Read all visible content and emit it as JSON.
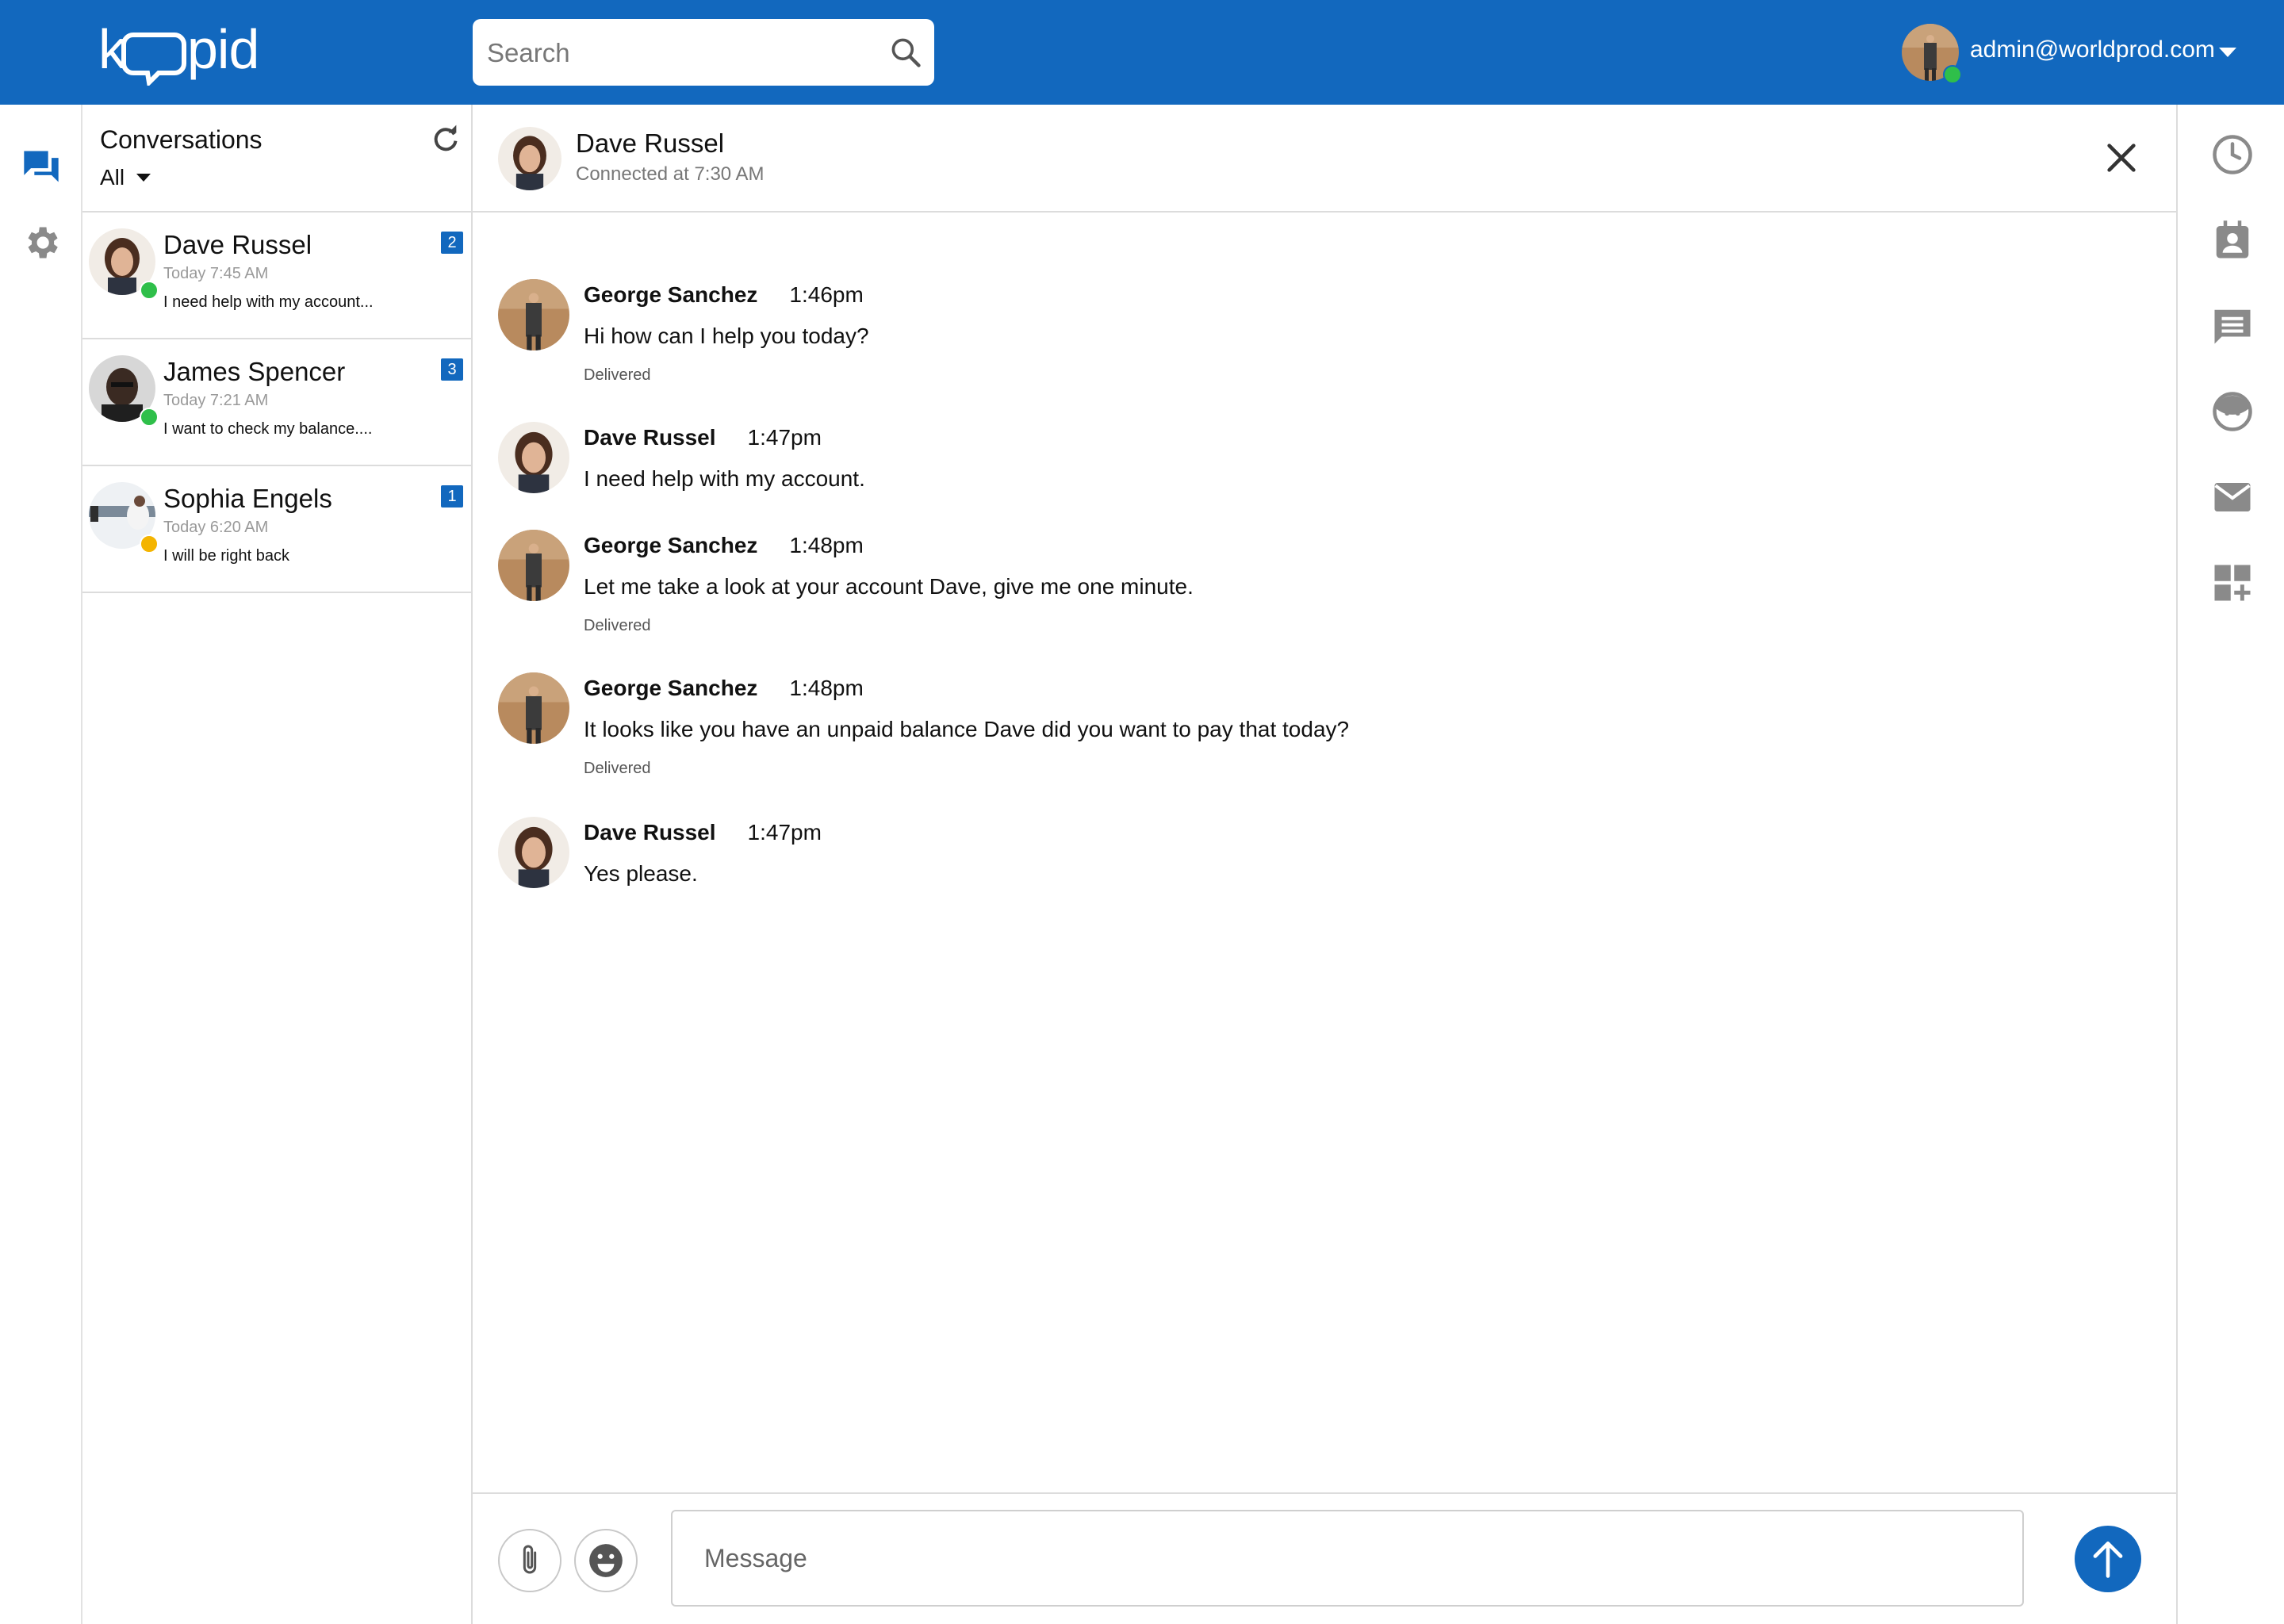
{
  "app": {
    "logo_text": "kopid",
    "brand_color": "#1268be"
  },
  "header": {
    "search_placeholder": "Search",
    "user_email": "admin@worldprod.com",
    "user_status_color": "#2fbf4a"
  },
  "left_nav": {
    "items": [
      {
        "icon": "chat-icon",
        "active": true
      },
      {
        "icon": "gear-icon",
        "active": false
      }
    ]
  },
  "conversations": {
    "title": "Conversations",
    "filter": "All",
    "items": [
      {
        "name": "Dave Russel",
        "time": "Today 7:45 AM",
        "preview": "I need help with my account...",
        "badge": "2",
        "status_color": "#2fbf4a"
      },
      {
        "name": "James Spencer",
        "time": "Today 7:21 AM",
        "preview": "I want to check my balance....",
        "badge": "3",
        "status_color": "#2fbf4a"
      },
      {
        "name": "Sophia Engels",
        "time": "Today 6:20 AM",
        "preview": "I will be right back",
        "badge": "1",
        "status_color": "#f4b400"
      }
    ]
  },
  "chat": {
    "contact_name": "Dave Russel",
    "status": "Connected at 7:30 AM",
    "messages": [
      {
        "sender": "George Sanchez",
        "time": "1:46pm",
        "text": "Hi how can I help you today?",
        "delivered": "Delivered"
      },
      {
        "sender": "Dave Russel",
        "time": "1:47pm",
        "text": "I need help with my account.",
        "delivered": ""
      },
      {
        "sender": "George Sanchez",
        "time": "1:48pm",
        "text": "Let me take a look at your account Dave, give me one minute.",
        "delivered": "Delivered"
      },
      {
        "sender": "George Sanchez",
        "time": "1:48pm",
        "text": "It looks like you have an unpaid balance Dave did you want to pay that today?",
        "delivered": "Delivered"
      },
      {
        "sender": "Dave Russel",
        "time": "1:47pm",
        "text": "Yes please.",
        "delivered": ""
      }
    ],
    "composer_placeholder": "Message"
  },
  "right_rail": {
    "items": [
      "clock-icon",
      "contact-card-icon",
      "message-icon",
      "face-icon",
      "mail-icon",
      "add-widget-icon"
    ]
  }
}
